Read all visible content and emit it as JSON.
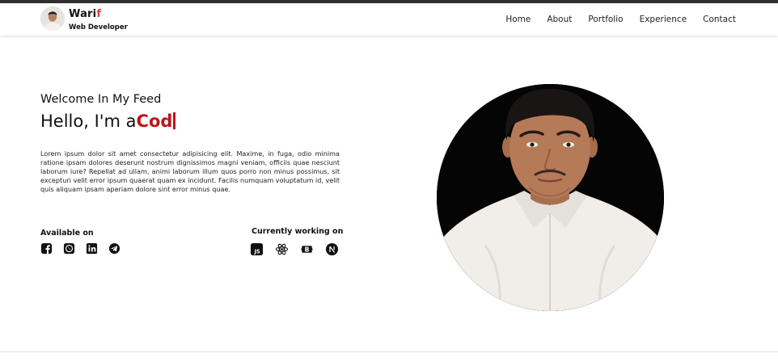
{
  "brand": {
    "name_main": "Wari",
    "name_accent": "f",
    "subtitle": "Web Developer",
    "accent_color": "#e53935"
  },
  "nav": {
    "items": [
      {
        "label": "Home"
      },
      {
        "label": "About"
      },
      {
        "label": "Portfolio"
      },
      {
        "label": "Experience"
      },
      {
        "label": "Contact"
      }
    ]
  },
  "hero": {
    "welcome": "Welcome In My Feed",
    "hello_prefix": "Hello, I'm a",
    "typed_text": "Cod",
    "typed_color": "#c0141c",
    "bio": "Lorem ipsum dolor sit amet consectetur adipisicing elit. Maxime, in fuga, odio minima ratione ipsam dolores deserunt nostrum dignissimos magni veniam, officiis quae nesciunt laborum iure? Repellat ad ullam, animi laborum illum quos porro non minus possimus, sit excepturi velit error ipsum quaerat quam ex incidunt. Facilis numquam voluptatum id, velit quis aliquam ipsam aperiam dolore sint error minus quae."
  },
  "available": {
    "title": "Available on",
    "icons": [
      "facebook-icon",
      "whatsapp-icon",
      "linkedin-icon",
      "telegram-icon"
    ]
  },
  "working": {
    "title": "Currently working on",
    "icons": [
      "javascript-icon",
      "react-icon",
      "bootstrap-icon",
      "nextjs-icon"
    ]
  }
}
